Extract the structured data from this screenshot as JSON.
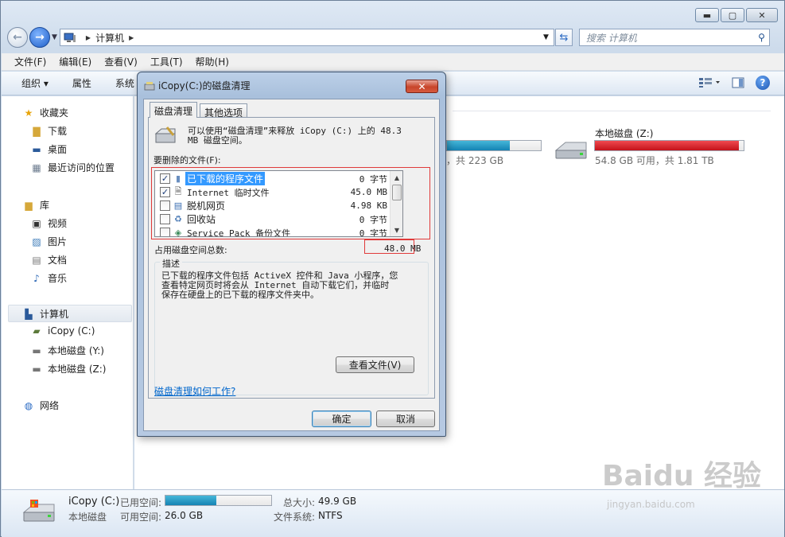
{
  "window": {
    "address": [
      "计算机"
    ],
    "search_placeholder": "搜索 计算机",
    "caption": {
      "min": "▬",
      "max": "▢",
      "close": "✕"
    }
  },
  "menu": [
    "文件(F)",
    "编辑(E)",
    "查看(V)",
    "工具(T)",
    "帮助(H)"
  ],
  "toolbar": {
    "organize": "组织 ▾",
    "properties": "属性",
    "system": "系统"
  },
  "nav": {
    "favorites": "收藏夹",
    "downloads": "下载",
    "desktop": "桌面",
    "recent": "最近访问的位置",
    "libraries": "库",
    "videos": "视频",
    "pictures": "图片",
    "documents": "文档",
    "music": "音乐",
    "computer": "计算机",
    "drive_c": "iCopy (C:)",
    "drive_y": "本地磁盘 (Y:)",
    "drive_z": "本地磁盘 (Z:)",
    "network": "网络"
  },
  "content": {
    "drive_y_partial": "，共 223 GB",
    "drive_y_fill": 0.67,
    "drive_z": {
      "name": "本地磁盘 (Z:)",
      "info": "54.8 GB 可用，共 1.81 TB",
      "fill": 0.97,
      "color": "#d4121b"
    }
  },
  "details": {
    "name": "iCopy (C:)",
    "type": "本地磁盘",
    "used_label": "已用空间:",
    "free_label": "可用空间:",
    "free_value": "26.0 GB",
    "total_label": "总大小:",
    "total_value": "49.9 GB",
    "fs_label": "文件系统:",
    "fs_value": "NTFS",
    "used_fill": 0.48
  },
  "dialog": {
    "title": "iCopy(C:)的磁盘清理",
    "close": "✕",
    "tabs": [
      "磁盘清理",
      "其他选项"
    ],
    "intro_line1": "可以使用“磁盘清理”来释放 iCopy (C:) 上的 48.3",
    "intro_line2": "MB 磁盘空间。",
    "files_label": "要删除的文件(F):",
    "files": [
      {
        "checked": true,
        "name": "已下载的程序文件",
        "size": "0 字节",
        "icon": "▮",
        "selected": true
      },
      {
        "checked": true,
        "name": "Internet 临时文件",
        "size": "45.0 MB",
        "icon": "🗎",
        "selected": false
      },
      {
        "checked": false,
        "name": "脱机网页",
        "size": "4.98 KB",
        "icon": "▤",
        "selected": false
      },
      {
        "checked": false,
        "name": "回收站",
        "size": "0 字节",
        "icon": "♻",
        "selected": false
      },
      {
        "checked": false,
        "name": "Service Pack 备份文件",
        "size": "0 字节",
        "icon": "◈",
        "selected": false
      }
    ],
    "total_label": "占用磁盘空间总数:",
    "total_value": "48.0 MB",
    "desc_legend": "描述",
    "desc_line1": "已下载的程序文件包括 ActiveX 控件和 Java 小程序，您",
    "desc_line2": "查看特定网页时将会从 Internet 自动下载它们，并临时",
    "desc_line3": "保存在硬盘上的已下载的程序文件夹中。",
    "view_files": "查看文件(V)",
    "how_link": "磁盘清理如何工作?",
    "ok": "确定",
    "cancel": "取消"
  },
  "watermark": {
    "brand": "Baidu 经验",
    "url": "jingyan.baidu.com"
  }
}
